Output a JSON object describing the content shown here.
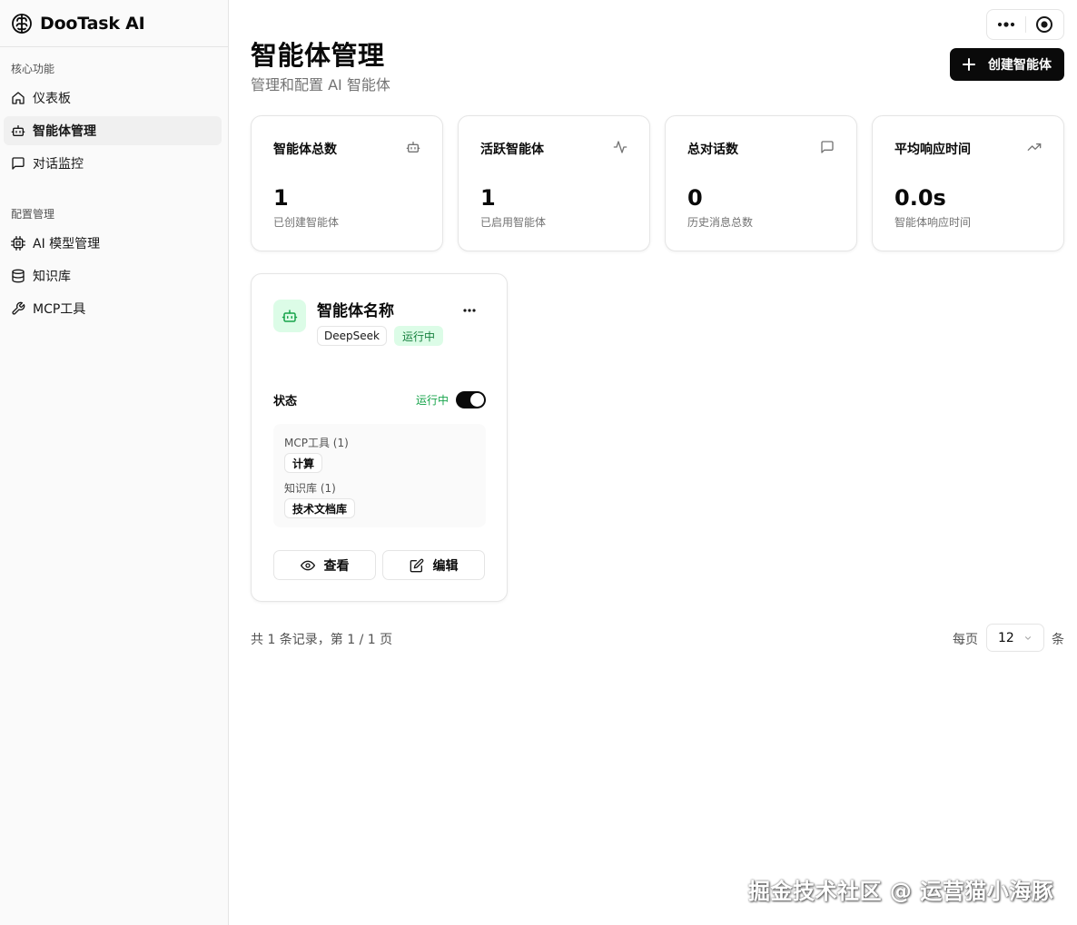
{
  "app": {
    "name": "DooTask AI"
  },
  "sidebar": {
    "groups": [
      {
        "label": "核心功能",
        "items": [
          {
            "label": "仪表板",
            "icon": "home-icon"
          },
          {
            "label": "智能体管理",
            "icon": "bot-icon",
            "active": true
          },
          {
            "label": "对话监控",
            "icon": "message-square-icon"
          }
        ]
      },
      {
        "label": "配置管理",
        "items": [
          {
            "label": "AI 模型管理",
            "icon": "cpu-icon"
          },
          {
            "label": "知识库",
            "icon": "database-icon"
          },
          {
            "label": "MCP工具",
            "icon": "wrench-icon"
          }
        ]
      }
    ]
  },
  "header": {
    "title": "智能体管理",
    "subtitle": "管理和配置 AI 智能体",
    "create_label": "创建智能体"
  },
  "stats": [
    {
      "title": "智能体总数",
      "value": "1",
      "desc": "已创建智能体",
      "icon": "bot-icon"
    },
    {
      "title": "活跃智能体",
      "value": "1",
      "desc": "已启用智能体",
      "icon": "activity-icon"
    },
    {
      "title": "总对话数",
      "value": "0",
      "desc": "历史消息总数",
      "icon": "message-square-icon"
    },
    {
      "title": "平均响应时间",
      "value": "0.0s",
      "desc": "智能体响应时间",
      "icon": "trending-up-icon"
    }
  ],
  "agent": {
    "name": "智能体名称",
    "model": "DeepSeek",
    "status_badge": "运行中",
    "status_label": "状态",
    "status_value": "运行中",
    "enabled": true,
    "mcp_label": "MCP工具 (1)",
    "mcp_tools": [
      "计算"
    ],
    "kb_label": "知识库 (1)",
    "knowledge_bases": [
      "技术文档库"
    ],
    "view_label": "查看",
    "edit_label": "编辑"
  },
  "pagination": {
    "summary": "共 1 条记录，第 1 / 1 页",
    "per_page_label": "每页",
    "per_page_value": "12",
    "per_page_unit": "条"
  },
  "watermark": "掘金技术社区 @ 运营猫小海豚",
  "colors": {
    "accent": "#0a0a0a",
    "success": "#16a34a",
    "success_bg": "#dcfce7"
  }
}
